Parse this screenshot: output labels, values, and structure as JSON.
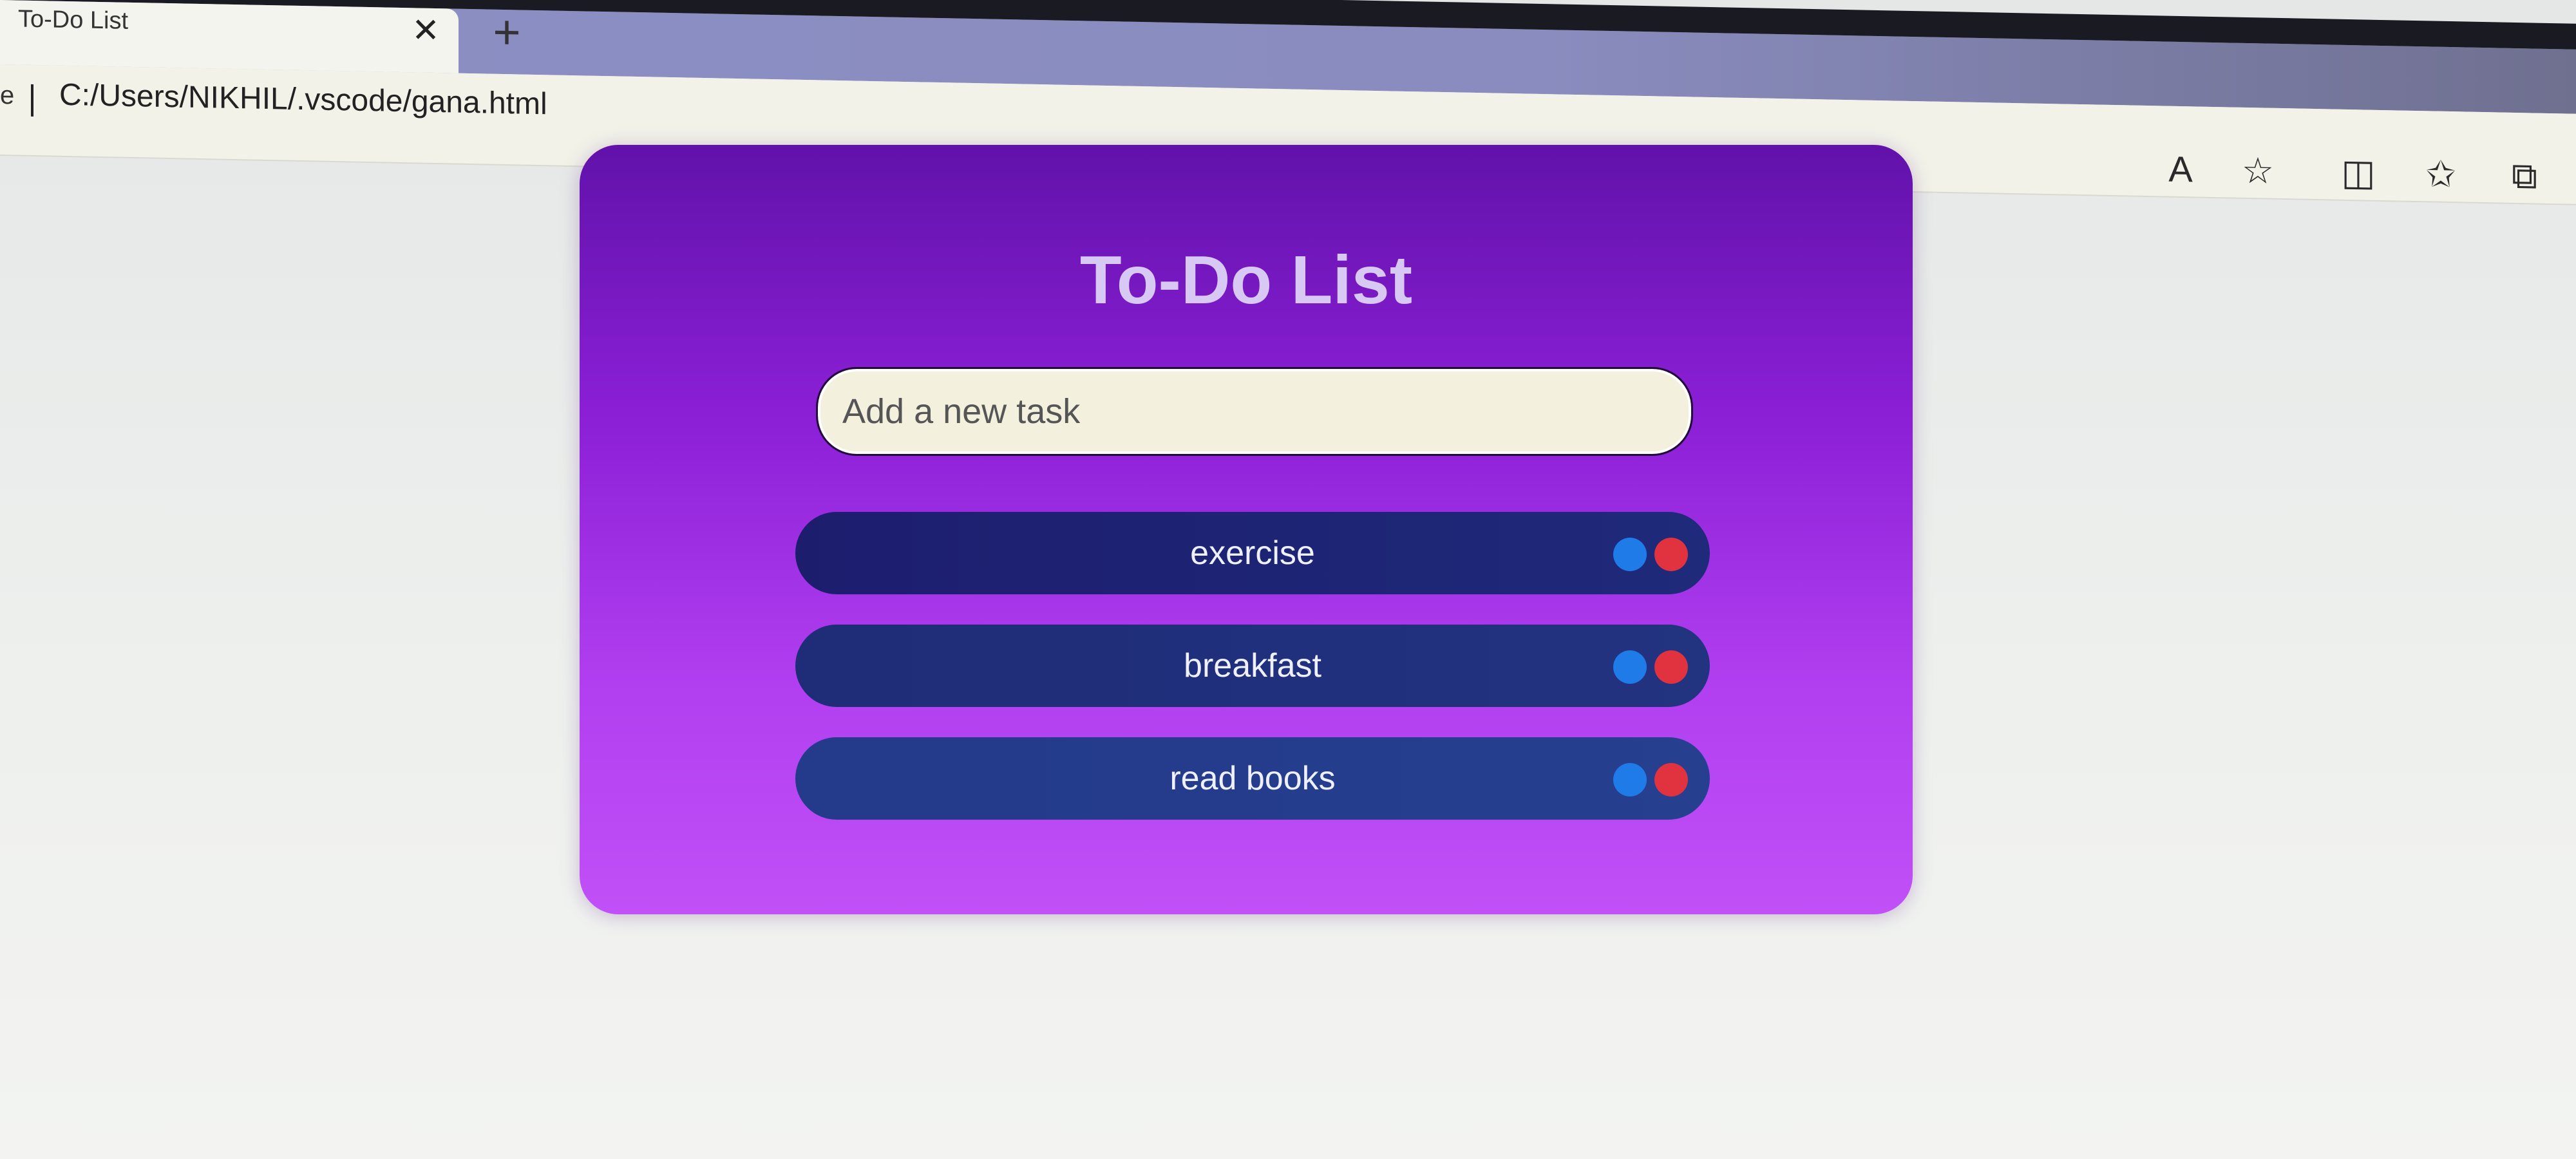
{
  "browser": {
    "tab_title": "To-Do List",
    "tab_close": "✕",
    "new_tab": "+",
    "back_glyph": "e",
    "url": "C:/Users/NIKHIL/.vscode/gana.html",
    "toolbar_icons": [
      {
        "name": "read-aloud-icon",
        "glyph": "A"
      },
      {
        "name": "favorite-star-icon",
        "glyph": "☆"
      },
      {
        "name": "split-screen-icon",
        "glyph": "◫"
      },
      {
        "name": "favorites-list-icon",
        "glyph": "✩"
      },
      {
        "name": "collections-icon",
        "glyph": "⧉"
      }
    ]
  },
  "app": {
    "title": "To-Do List",
    "input": {
      "placeholder": "Add a new task",
      "value": ""
    },
    "tasks": [
      {
        "label": "exercise"
      },
      {
        "label": "breakfast"
      },
      {
        "label": "read books"
      }
    ],
    "colors": {
      "edit_button": "#1f7be8",
      "delete_button": "#e0333f",
      "card_top": "#6112aa",
      "card_bottom": "#c150f7"
    }
  }
}
